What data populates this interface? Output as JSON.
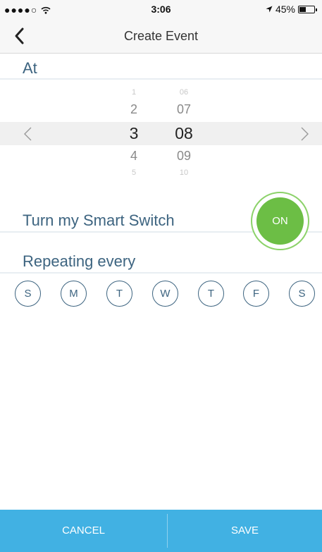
{
  "status_bar": {
    "signal": "●●●●○",
    "time": "3:06",
    "battery_pct": "45%",
    "battery_level": 0.45
  },
  "nav": {
    "title": "Create Event",
    "back_icon": "chevron-left-icon"
  },
  "at": {
    "label": "At"
  },
  "time_picker": {
    "hours": [
      "1",
      "2",
      "3",
      "4",
      "5"
    ],
    "minutes": [
      "06",
      "07",
      "08",
      "09",
      "10"
    ],
    "selected_hour": "3",
    "selected_minute": "08"
  },
  "switch": {
    "label": "Turn my Smart Switch",
    "state": "ON",
    "color": "#6cbe45"
  },
  "repeat": {
    "label": "Repeating every",
    "days": [
      "S",
      "M",
      "T",
      "W",
      "T",
      "F",
      "S"
    ]
  },
  "footer": {
    "cancel": "CANCEL",
    "save": "SAVE",
    "color": "#41b1e3"
  }
}
